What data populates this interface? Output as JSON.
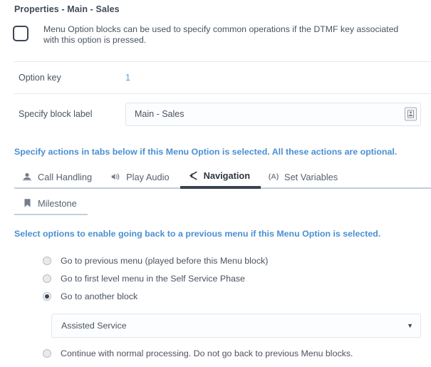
{
  "header": {
    "title": "Properties - Main - Sales"
  },
  "description": {
    "checkbox_checked": false,
    "text": "Menu Option blocks can be used to specify common operations if the DTMF key associated with this option is pressed."
  },
  "fields": {
    "option_key": {
      "label": "Option key",
      "value": "1"
    },
    "block_label": {
      "label": "Specify block label",
      "value": "Main - Sales",
      "placeholder": "Main - Sales",
      "icon": "insert-variable-icon"
    }
  },
  "hints": {
    "tabs_hint": "Specify actions in tabs below if this Menu Option is selected. All these actions are optional.",
    "navigation_hint": "Select options to enable going back to a previous menu if this Menu Option is selected."
  },
  "tabs": {
    "row1": [
      {
        "label": "Call Handling",
        "icon": "agent-headset-icon",
        "active": false
      },
      {
        "label": "Play Audio",
        "icon": "speaker-audio-icon",
        "active": false
      },
      {
        "label": "Navigation",
        "icon": "branch-arrow-icon",
        "active": true
      },
      {
        "label": "Set Variables",
        "icon": "variable-a-icon",
        "active": false
      }
    ],
    "row2": [
      {
        "label": "Milestone",
        "icon": "bookmark-flag-icon",
        "active": false
      }
    ],
    "set_variables_icon_text": "(A)"
  },
  "navigation": {
    "options": [
      {
        "label": "Go to previous menu (played before this Menu block)",
        "selected": false
      },
      {
        "label": "Go to first level menu in the Self Service Phase",
        "selected": false
      },
      {
        "label": "Go to another block",
        "selected": true
      }
    ],
    "block_select": {
      "value": "Assisted Service",
      "arrow": "▼"
    },
    "last_option": {
      "label": "Continue with normal processing. Do not go back to previous Menu blocks.",
      "selected": false
    }
  },
  "colors": {
    "accent_blue": "#4a8fd2",
    "link_blue": "#5b9bd5",
    "active_tab": "#3b4350",
    "divider": "#e3e9f0"
  }
}
